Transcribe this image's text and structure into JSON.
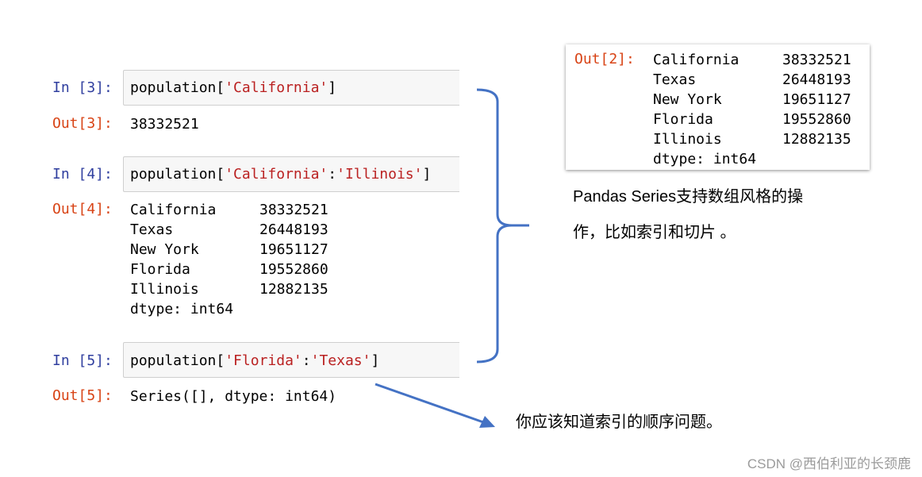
{
  "cells": {
    "in3": {
      "prompt": "In [3]:",
      "code_prefix": "population[",
      "code_string": "'California'",
      "code_suffix": "]"
    },
    "out3": {
      "prompt": "Out[3]:",
      "value": "38332521"
    },
    "in4": {
      "prompt": "In [4]:",
      "code_prefix": "population[",
      "code_string1": "'California'",
      "code_colon": ":",
      "code_string2": "'Illinois'",
      "code_suffix": "]"
    },
    "out4": {
      "prompt": "Out[4]:",
      "rows": [
        {
          "key": "California",
          "value": "38332521"
        },
        {
          "key": "Texas",
          "value": "26448193"
        },
        {
          "key": "New York",
          "value": "19651127"
        },
        {
          "key": "Florida",
          "value": "19552860"
        },
        {
          "key": "Illinois",
          "value": "12882135"
        }
      ],
      "dtype": "dtype: int64"
    },
    "in5": {
      "prompt": "In [5]:",
      "code_prefix": "population[",
      "code_string1": "'Florida'",
      "code_colon": ":",
      "code_string2": "'Texas'",
      "code_suffix": "]"
    },
    "out5": {
      "prompt": "Out[5]:",
      "value": "Series([], dtype: int64)"
    }
  },
  "out2_box": {
    "prompt": "Out[2]:",
    "rows": [
      {
        "key": "California",
        "value": "38332521"
      },
      {
        "key": "Texas",
        "value": "26448193"
      },
      {
        "key": "New York",
        "value": "19651127"
      },
      {
        "key": "Florida",
        "value": "19552860"
      },
      {
        "key": "Illinois",
        "value": "12882135"
      }
    ],
    "dtype": "dtype: int64"
  },
  "annotations": {
    "note1_line1": "Pandas Series支持数组风格的操",
    "note1_line2": "作，比如索引和切片 。",
    "note2": "你应该知道索引的顺序问题。"
  },
  "watermark": "CSDN @西伯利亚的长颈鹿",
  "colors": {
    "in_prompt": "#303f9f",
    "out_prompt": "#d84315",
    "string_literal": "#ba2121",
    "cell_background": "#f7f7f7",
    "arrow_blue": "#4472c4",
    "watermark": "#9b9b9b"
  }
}
